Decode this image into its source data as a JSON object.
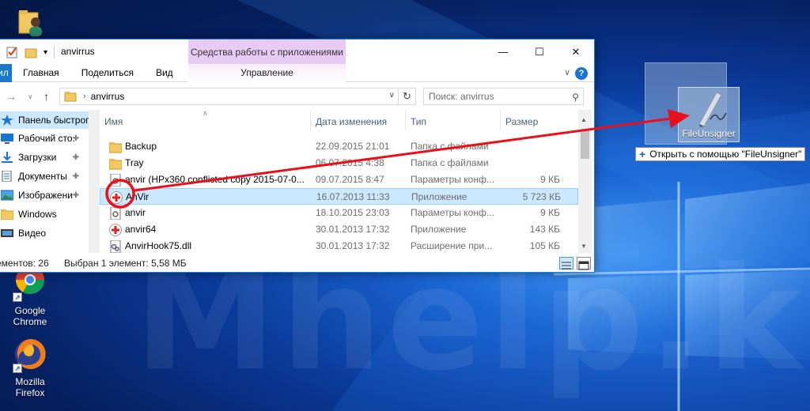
{
  "desktop": {
    "watermark": "Mhelp.kz",
    "icons": [
      {
        "label": "Google Chrome",
        "icon": "chrome-icon"
      },
      {
        "label": "Mozilla Firefox",
        "icon": "firefox-icon"
      }
    ],
    "dragged_shortcut": {
      "label": "FileUnsigner",
      "tooltip_prefix": "+",
      "tooltip": "Открыть с помощью \"FileUnsigner\""
    }
  },
  "window": {
    "title": "anvirrus",
    "tools_tab": "Средства работы с приложениями",
    "tools_subtab": "Управление",
    "caption": {
      "minimize": "—",
      "maximize": "☐",
      "close": "✕"
    },
    "ribbon_tabs": [
      "Главная",
      "Поделиться",
      "Вид"
    ],
    "file_tab": "ил",
    "help": "?",
    "address": "anvirrus",
    "search_placeholder": "Поиск: anvirrus"
  },
  "nav_pane": {
    "items": [
      {
        "label": "Панель быстрого",
        "icon": "star-icon",
        "pinned": false
      },
      {
        "label": "Рабочий сто.",
        "icon": "desktop-icon",
        "pinned": true
      },
      {
        "label": "Загрузки",
        "icon": "download-icon",
        "pinned": true
      },
      {
        "label": "Документы",
        "icon": "documents-icon",
        "pinned": true
      },
      {
        "label": "Изображени",
        "icon": "pictures-icon",
        "pinned": true
      },
      {
        "label": "Windows",
        "icon": "folder-icon",
        "pinned": false
      },
      {
        "label": "Видео",
        "icon": "video-icon",
        "pinned": false
      }
    ]
  },
  "file_list": {
    "columns": [
      "Имя",
      "Дата изменения",
      "Тип",
      "Размер"
    ],
    "rows": [
      {
        "name": "Backup",
        "date": "22.09.2015 21:01",
        "type": "Папка с файлами",
        "size": "",
        "icon": "folder-icon"
      },
      {
        "name": "Tray",
        "date": "06.07.2015 4:38",
        "type": "Папка с файлами",
        "size": "",
        "icon": "folder-icon"
      },
      {
        "name": "anvir (HPx360 conflicted copy 2015-07-0...",
        "date": "09.07.2015 8:47",
        "type": "Параметры конф...",
        "size": "9 КБ",
        "icon": "config-file-icon"
      },
      {
        "name": "AnVir",
        "date": "16.07.2013 11:33",
        "type": "Приложение",
        "size": "5 723 КБ",
        "icon": "anvir-app-icon",
        "selected": true
      },
      {
        "name": "anvir",
        "date": "18.10.2015 23:03",
        "type": "Параметры конф...",
        "size": "9 КБ",
        "icon": "config-file-icon"
      },
      {
        "name": "anvir64",
        "date": "30.01.2013 17:32",
        "type": "Приложение",
        "size": "143 КБ",
        "icon": "anvir-app-icon"
      },
      {
        "name": "AnvirHook75.dll",
        "date": "30.01.2013 17:32",
        "type": "Расширение при...",
        "size": "105 КБ",
        "icon": "dll-file-icon"
      }
    ]
  },
  "status_bar": {
    "items_count": "ементов: 26",
    "selection": "Выбран 1 элемент: 5,58 МБ"
  },
  "colors": {
    "accent": "#1979ca",
    "annotation": "#e8101a",
    "tools_tab": "#e7cbf5",
    "selection": "#cce8ff"
  }
}
